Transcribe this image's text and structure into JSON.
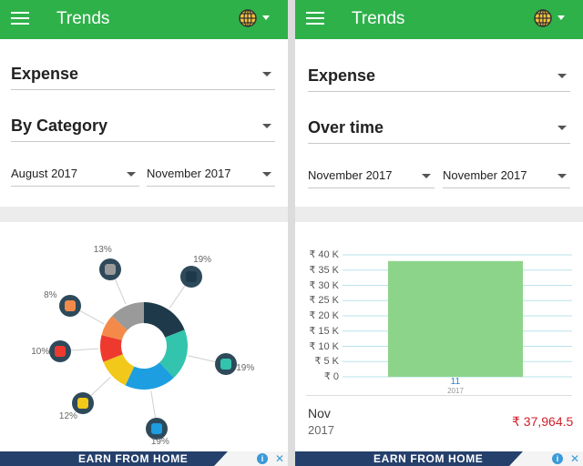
{
  "left": {
    "appbar": {
      "title": "Trends"
    },
    "filters": {
      "type": "Expense",
      "view": "By Category",
      "from": "August 2017",
      "to": "November 2017"
    },
    "ad": {
      "text": "EARN FROM HOME"
    }
  },
  "right": {
    "appbar": {
      "title": "Trends"
    },
    "filters": {
      "type": "Expense",
      "view": "Over time",
      "from": "November 2017",
      "to": "November 2017"
    },
    "summary": {
      "month": "Nov",
      "year": "2017",
      "amount": "₹ 37,964.5"
    },
    "ad": {
      "text": "EARN FROM HOME"
    }
  },
  "chart_data": [
    {
      "type": "pie",
      "title": "",
      "slices": [
        {
          "label": "19%",
          "value": 19,
          "color": "#1e3a4a",
          "icon": "graduation-cap-icon"
        },
        {
          "label": "19%",
          "value": 19,
          "color": "#33c4ae",
          "icon": "cash-register-icon"
        },
        {
          "label": "19%",
          "value": 19,
          "color": "#1d9ee0",
          "icon": "cocktail-icon"
        },
        {
          "label": "12%",
          "value": 12,
          "color": "#f2c81a",
          "icon": "briefcase-icon"
        },
        {
          "label": "10%",
          "value": 10,
          "color": "#ee3a2e",
          "icon": "bill-icon"
        },
        {
          "label": "8%",
          "value": 8,
          "color": "#f48a4a",
          "icon": "basket-icon"
        },
        {
          "label": "13%",
          "value": 13,
          "color": "#9a9a9a",
          "icon": "money-stack-icon"
        }
      ]
    },
    {
      "type": "bar",
      "title": "",
      "categories": [
        "11"
      ],
      "category_sub": "2017",
      "values": [
        37964.5
      ],
      "ylim": [
        0,
        40000
      ],
      "yticks": [
        {
          "v": 0,
          "label": "₹ 0"
        },
        {
          "v": 5000,
          "label": "₹ 5 K"
        },
        {
          "v": 10000,
          "label": "₹ 10 K"
        },
        {
          "v": 15000,
          "label": "₹ 15 K"
        },
        {
          "v": 20000,
          "label": "₹ 20 K"
        },
        {
          "v": 25000,
          "label": "₹ 25 K"
        },
        {
          "v": 30000,
          "label": "₹ 30 K"
        },
        {
          "v": 35000,
          "label": "₹ 35 K"
        },
        {
          "v": 40000,
          "label": "₹ 40 K"
        }
      ],
      "grid": true,
      "bar_color": "#8dd48b"
    }
  ]
}
